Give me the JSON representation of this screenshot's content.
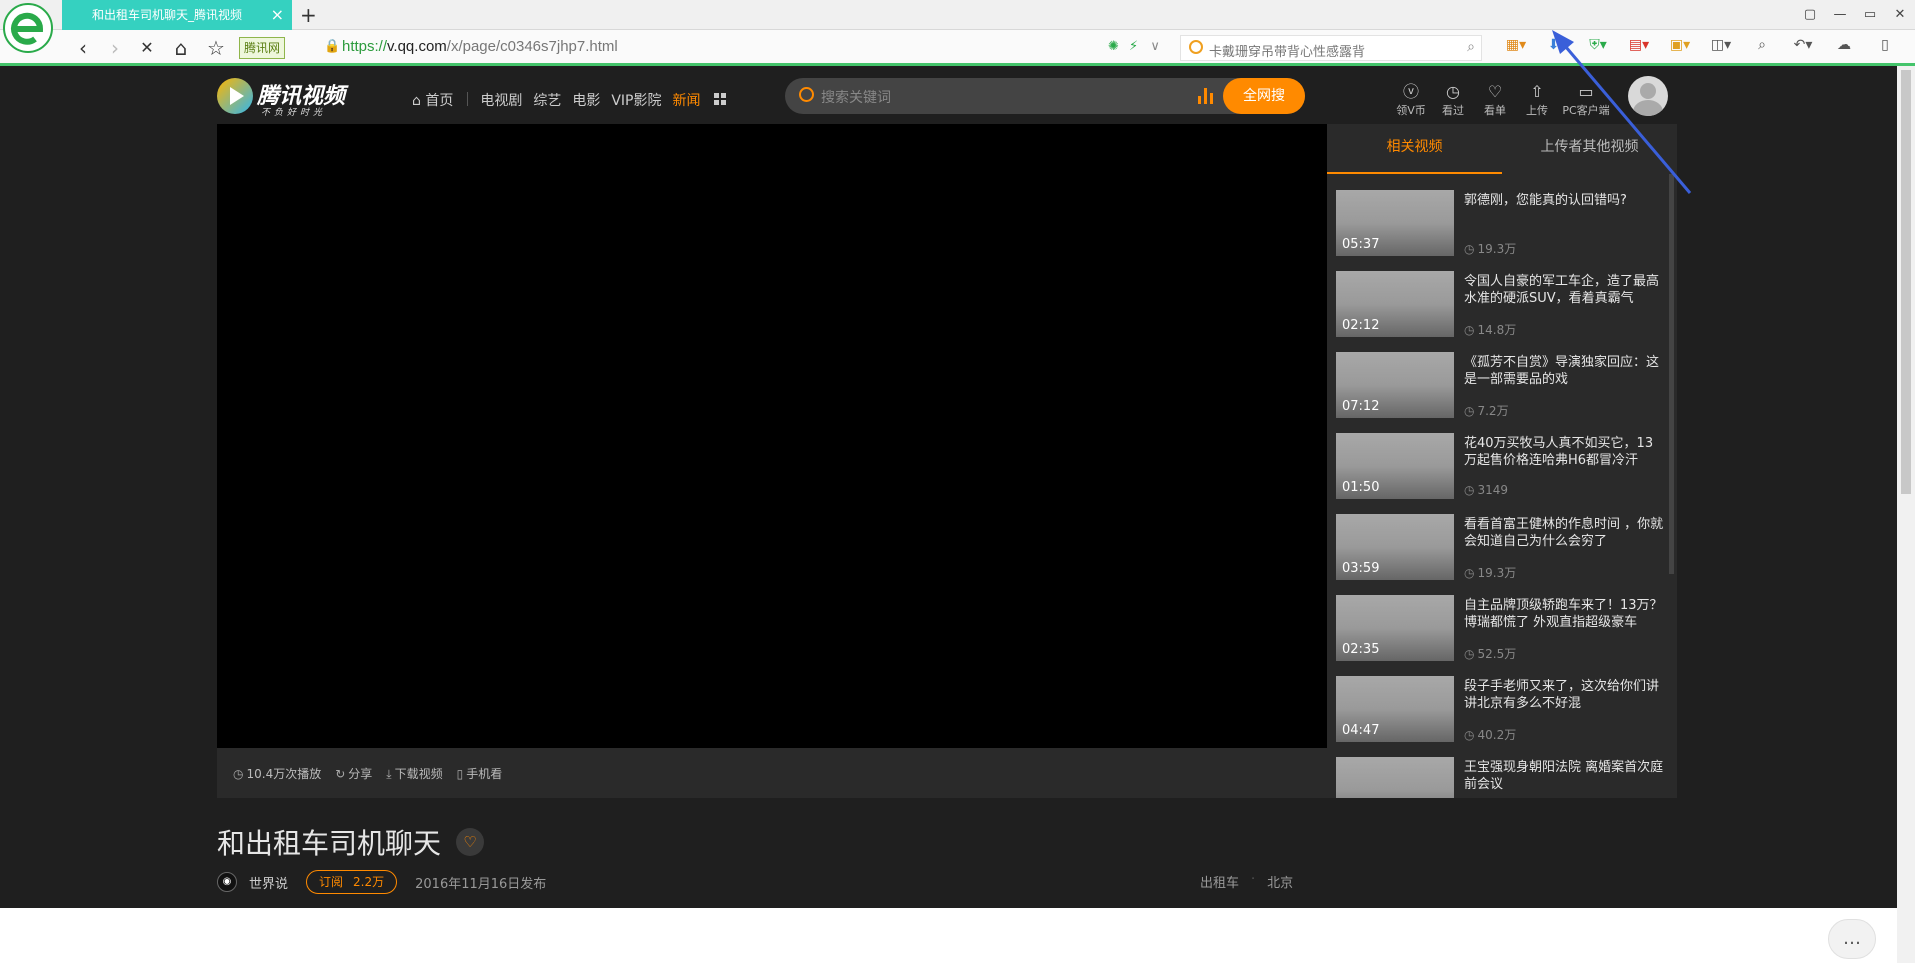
{
  "browser": {
    "tab_title": "和出租车司机聊天_腾讯视频",
    "tab_close": "×",
    "new_tab": "+",
    "site_badge": "腾讯网",
    "url_scheme": "https://",
    "url_domain": "v.qq.com",
    "url_path": "/x/page/c0346s7jhp7.html",
    "search_placeholder": "卡戴珊穿吊带背心性感露背",
    "nav_back": "‹",
    "nav_forward": "›",
    "nav_stop": "✕",
    "nav_home": "⌂",
    "nav_favorite": "☆",
    "win_restore": "▢",
    "win_min": "—",
    "win_max": "▭",
    "win_close": "✕"
  },
  "site": {
    "logo_name": "腾讯视频",
    "logo_slogan": "不负好时光",
    "nav": {
      "home": "首页",
      "tv": "电视剧",
      "variety": "综艺",
      "movie": "电影",
      "vip": "VIP影院",
      "news": "新闻"
    },
    "search_placeholder": "搜索关键词",
    "search_button": "全网搜",
    "tools": {
      "vcoin": "领V币",
      "history": "看过",
      "watchlist": "看单",
      "upload": "上传",
      "pc_client": "PC客户端"
    }
  },
  "player": {
    "plays": "10.4万次播放",
    "share": "分享",
    "download": "下载视频",
    "mobile": "手机看"
  },
  "sidebar": {
    "tab_related": "相关视频",
    "tab_uploader": "上传者其他视频",
    "videos": [
      {
        "title": "郭德刚，您能真的认回错吗?",
        "duration": "05:37",
        "views": "19.3万"
      },
      {
        "title": "令国人自豪的军工车企，造了最高水准的硬派SUV，看着真霸气",
        "duration": "02:12",
        "views": "14.8万"
      },
      {
        "title": "《孤芳不自赏》导演独家回应：这是一部需要品的戏",
        "duration": "07:12",
        "views": "7.2万"
      },
      {
        "title": "花40万买牧马人真不如买它，13万起售价格连哈弗H6都冒冷汗",
        "duration": "01:50",
        "views": "3149"
      },
      {
        "title": "看看首富王健林的作息时间 ，你就会知道自己为什么会穷了",
        "duration": "03:59",
        "views": "19.3万"
      },
      {
        "title": "自主品牌顶级轿跑车来了！13万？博瑞都慌了 外观直指超级豪车",
        "duration": "02:35",
        "views": "52.5万"
      },
      {
        "title": "段子手老师又来了，这次给你们讲讲北京有多么不好混",
        "duration": "04:47",
        "views": "40.2万"
      },
      {
        "title": "王宝强现身朝阳法院 离婚案首次庭前会议",
        "duration": "",
        "views": ""
      }
    ]
  },
  "video": {
    "title": "和出租车司机聊天",
    "uploader": "世界说",
    "subscribe_label": "订阅",
    "subscribe_count": "2.2万",
    "publish_date": "2016年11月16日发布",
    "tags": [
      "出租车",
      "北京"
    ]
  },
  "colors": {
    "accent": "#ff8a00",
    "page_bg": "#1f1f1f",
    "panel_bg": "#2a2a2a",
    "tab_active": "#35d1c0",
    "annotation_arrow": "#3a5fd9"
  }
}
